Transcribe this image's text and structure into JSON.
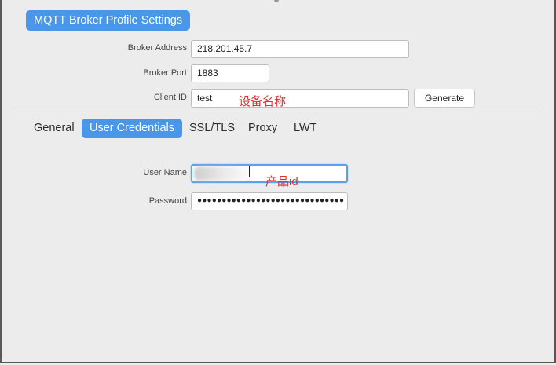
{
  "profile_title": "MQTT Broker Profile Settings",
  "fields": {
    "broker_address": {
      "label": "Broker Address",
      "value": "218.201.45.7"
    },
    "broker_port": {
      "label": "Broker Port",
      "value": "1883"
    },
    "client_id": {
      "label": "Client ID",
      "value": "test"
    },
    "generate_button": "Generate"
  },
  "tabs": [
    {
      "label": "General",
      "active": false
    },
    {
      "label": "User Credentials",
      "active": true
    },
    {
      "label": "SSL/TLS",
      "active": false
    },
    {
      "label": "Proxy",
      "active": false
    },
    {
      "label": "LWT",
      "active": false
    }
  ],
  "credentials": {
    "user_name_label": "User Name",
    "user_name_value": "",
    "password_label": "Password",
    "password_mask": "●●●●●●●●●●●●●●●●●●●●●●●●●●●●●●"
  },
  "annotations": {
    "client_id_note": "设备名称",
    "user_name_note": "产品id"
  },
  "colors": {
    "accent": "#4a96e8",
    "annotation": "#e03030",
    "background": "#ececec"
  }
}
